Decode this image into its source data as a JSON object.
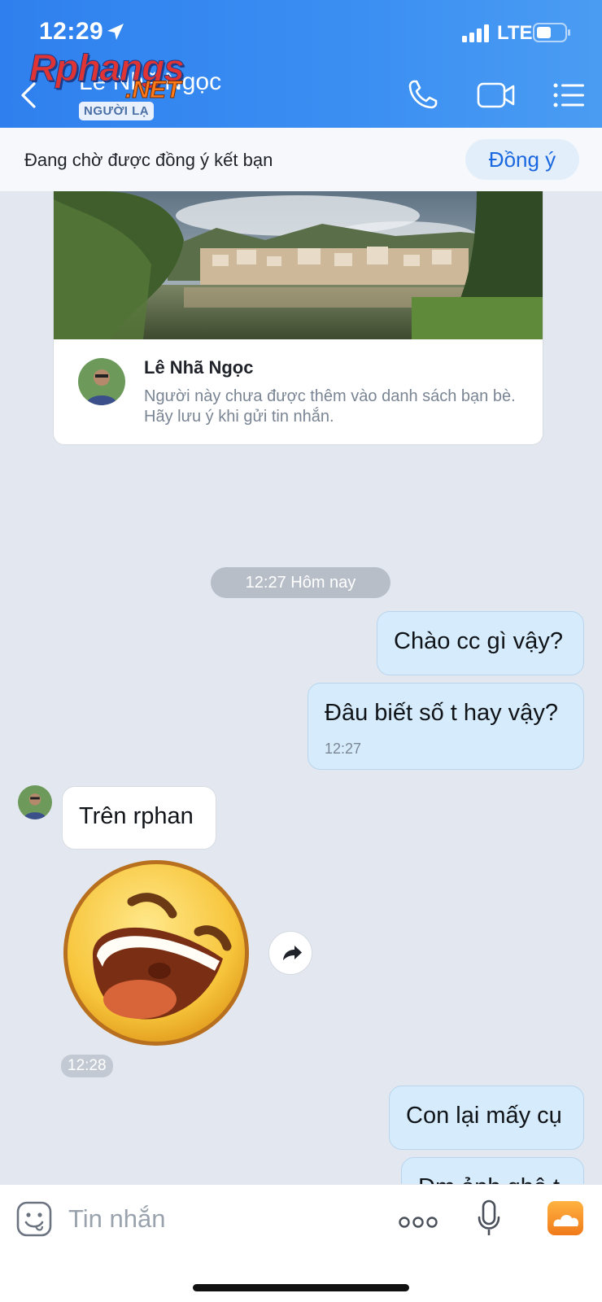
{
  "status_bar": {
    "time": "12:29",
    "network": "LTE"
  },
  "header": {
    "contact_name": "Lê Nhã Ngọc",
    "badge": "NGƯỜI LẠ",
    "watermark_main": "Rphangs",
    "watermark_sub": ".NET"
  },
  "friend_request": {
    "text": "Đang chờ được đồng ý kết bạn",
    "accept_label": "Đồng ý"
  },
  "profile_card": {
    "name": "Lê Nhã Ngọc",
    "note": "Người này chưa được thêm vào danh sách bạn bè. Hãy lưu ý khi gửi tin nhắn."
  },
  "date_separator": "12:27 Hôm nay",
  "messages": [
    {
      "direction": "out",
      "text": "Chào cc gì vậy?"
    },
    {
      "direction": "out",
      "text": "Đâu biết số t hay vậy?",
      "time": "12:27"
    },
    {
      "direction": "in",
      "text": "Trên rphan"
    },
    {
      "direction": "in",
      "type": "sticker",
      "sticker": "laughing-face",
      "time": "12:28"
    },
    {
      "direction": "out",
      "text": "Con lại mấy cụ"
    },
    {
      "direction": "out",
      "text": "Dm ảnh ghê t"
    }
  ],
  "composer": {
    "placeholder": "Tin nhắn"
  },
  "colors": {
    "header": "#3b8ff2",
    "accent": "#1a68e0",
    "outgoing_bubble": "#d6ecfc",
    "chat_bg": "#e3e8f0"
  },
  "icons": [
    "location-arrow-icon",
    "signal-icon",
    "battery-icon",
    "back-icon",
    "phone-icon",
    "video-icon",
    "menu-icon",
    "share-icon",
    "emoji-icon",
    "more-icon",
    "mic-icon",
    "photo-icon"
  ]
}
